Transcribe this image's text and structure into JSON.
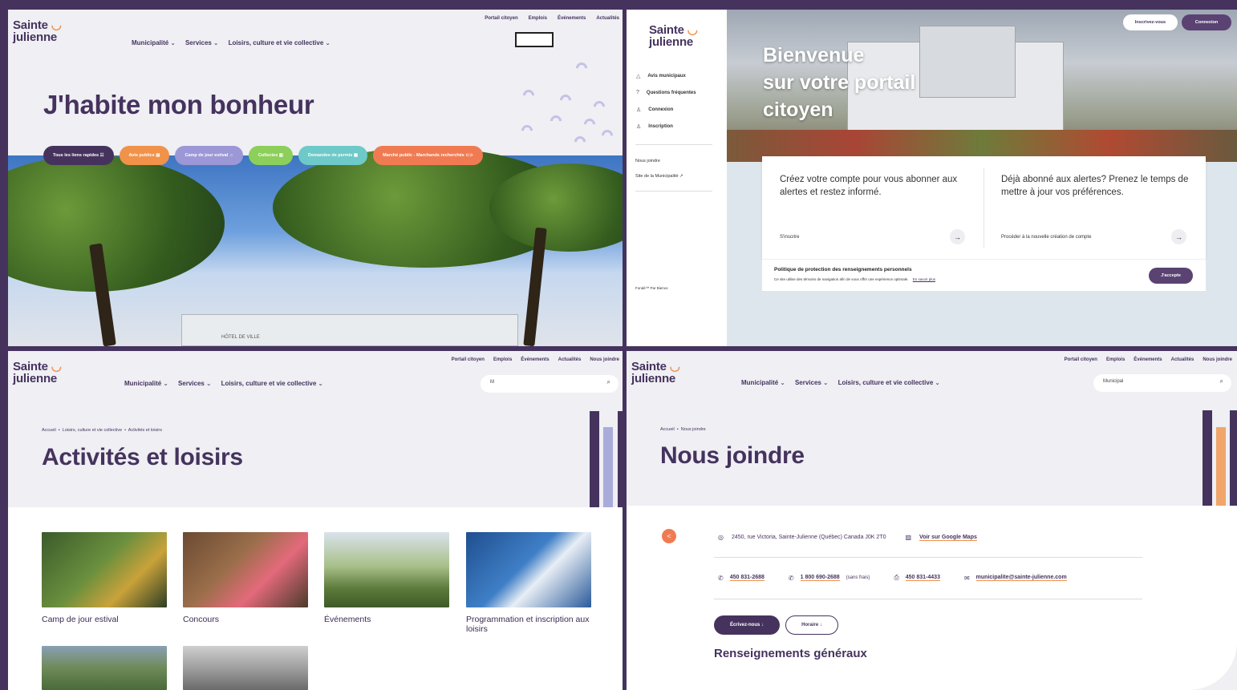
{
  "brand": {
    "line1": "Sainte",
    "line2": "julienne",
    "u": "ᴗ"
  },
  "p1": {
    "topnav": [
      "Portail citoyen",
      "Emplois",
      "Événements",
      "Actualités"
    ],
    "mainnav": [
      "Municipalité",
      "Services",
      "Loisirs, culture et vie collective"
    ],
    "title": "J'habite mon bonheur",
    "pills": [
      {
        "label": "Tous les liens rapides ☷",
        "color": "#45335e"
      },
      {
        "label": "Avis publics ▤",
        "color": "#f0924a"
      },
      {
        "label": "Camp de jour estival ☼",
        "color": "#9c97d6"
      },
      {
        "label": "Collectes ▥",
        "color": "#8ccf5a"
      },
      {
        "label": "Demandes de permis ▦",
        "color": "#6ec9c9"
      },
      {
        "label": "Marché public - Marchands recherchés ⊂⊃",
        "color": "#f07b52"
      }
    ],
    "sign": "HÔTEL DE VILLE"
  },
  "p2": {
    "side_items": [
      {
        "icon": "△",
        "label": "Avis municipaux"
      },
      {
        "icon": "?",
        "label": "Questions fréquentes"
      },
      {
        "icon": "♙",
        "label": "Connexion"
      },
      {
        "icon": "♙",
        "label": "Inscription"
      }
    ],
    "links": [
      "Nous joindre",
      "Site de la Municipalité ↗"
    ],
    "powered": "Fondé™ Par Bienvo",
    "welcome": [
      "Bienvenue",
      "sur votre portail",
      "citoyen"
    ],
    "btn_signup": "Inscrivez-vous",
    "btn_login": "Connexion",
    "card1": {
      "text": "Créez votre compte pour vous abonner aux alertes et restez informé.",
      "link": "S'inscrire"
    },
    "card2": {
      "text": "Déjà abonné aux alertes? Prenez le temps de mettre à jour vos préférences.",
      "link": "Procéder à la nouvelle création de compte"
    },
    "cookie_title": "Politique de protection des renseignements personnels",
    "cookie_text": "Ce site utilise des témoins de navigation afin de vous offrir une expérience optimale.",
    "cookie_link": "En savoir plus",
    "cookie_btn": "J'accepte"
  },
  "p3": {
    "topnav": [
      "Portail citoyen",
      "Emplois",
      "Événements",
      "Actualités",
      "Nous joindre"
    ],
    "mainnav": [
      "Municipalité",
      "Services",
      "Loisirs, culture et vie collective"
    ],
    "search_value": "M",
    "crumbs": [
      "Accueil",
      "Loisirs, culture et vie collective",
      "Activités et loisirs"
    ],
    "title": "Activités et loisirs",
    "tiles": [
      {
        "label": "Camp de jour estival"
      },
      {
        "label": "Concours"
      },
      {
        "label": "Événements"
      },
      {
        "label": "Programmation et inscription aux loisirs"
      }
    ]
  },
  "p4": {
    "topnav": [
      "Portail citoyen",
      "Emplois",
      "Événements",
      "Actualités",
      "Nous joindre"
    ],
    "mainnav": [
      "Municipalité",
      "Services",
      "Loisirs, culture et vie collective"
    ],
    "search_value": "Municipal",
    "crumbs": [
      "Accueil",
      "Nous joindre"
    ],
    "title": "Nous joindre",
    "address": "2450, rue Victoria, Sainte-Julienne (Québec) Canada J0K 2T0",
    "maps": "Voir sur Google Maps",
    "phone1": "450 831-2688",
    "phone2": "1 800 690-2688",
    "phone2_note": "(sans frais)",
    "fax": "450 831-4433",
    "email": "municipalite@sainte-julienne.com",
    "btn_write": "Écrivez-nous ↓",
    "btn_hours": "Horaire ↓",
    "section": "Renseignements généraux"
  }
}
